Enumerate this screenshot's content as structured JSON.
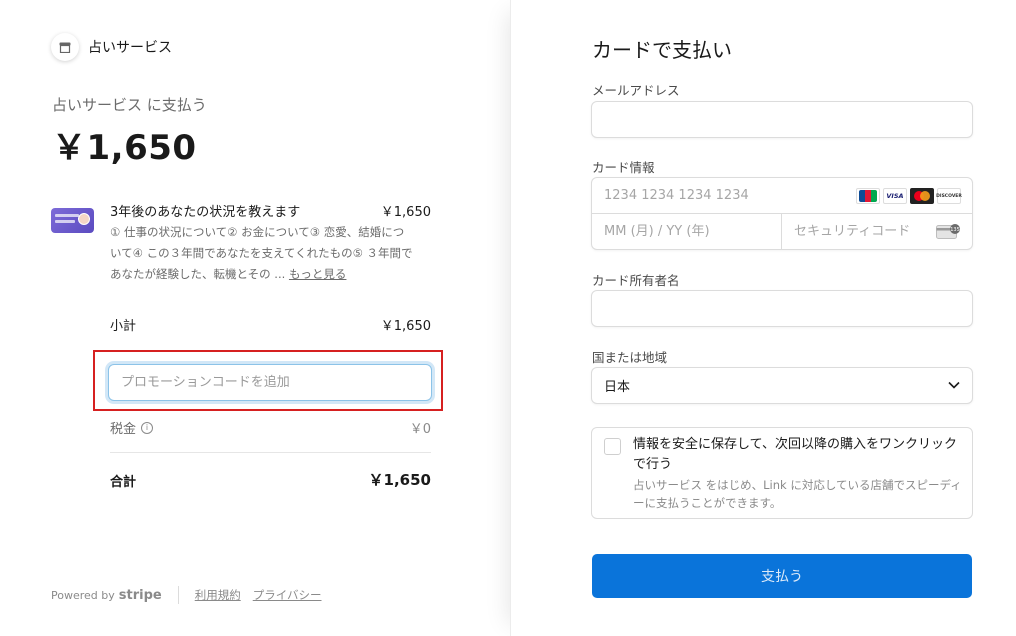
{
  "merchant": {
    "name": "占いサービス",
    "icon": "store-icon"
  },
  "summary": {
    "pay_to": "占いサービス に支払う",
    "amount": "￥1,650"
  },
  "line_item": {
    "title": "3年後のあなたの状況を教えます",
    "price": "￥1,650",
    "description": "① 仕事の状況について② お金について③ 恋愛、結婚について④ この３年間であなたを支えてくれたもの⑤ ３年間であなたが経験した、転機とその ...",
    "more_link": "もっと見る"
  },
  "subtotal": {
    "label": "小計",
    "value": "￥1,650"
  },
  "promo": {
    "placeholder": "プロモーションコードを追加"
  },
  "tax": {
    "label": "税金",
    "value": "￥0"
  },
  "total": {
    "label": "合計",
    "value": "￥1,650"
  },
  "footer": {
    "powered_by": "Powered by",
    "stripe": "stripe",
    "terms": "利用規約",
    "privacy": "プライバシー"
  },
  "payment": {
    "title": "カードで支払い",
    "email_label": "メールアドレス",
    "email_value": "",
    "card_label": "カード情報",
    "card_number_placeholder": "1234 1234 1234 1234",
    "expiry_placeholder": "MM (月) / YY (年)",
    "cvc_placeholder": "セキュリティコード",
    "card_brands": [
      "JCB",
      "VISA",
      "Mastercard",
      "DISCOVER"
    ],
    "cardholder_label": "カード所有者名",
    "cardholder_value": "",
    "country_label": "国または地域",
    "country_value": "日本",
    "save_title": "情報を安全に保存して、次回以降の購入をワンクリックで行う",
    "save_desc": "占いサービス をはじめ、Link に対応している店舗でスピーディーに支払うことができます。",
    "pay_button": "支払う",
    "button_color": "#0a74da"
  },
  "highlight_color": "#d62020"
}
